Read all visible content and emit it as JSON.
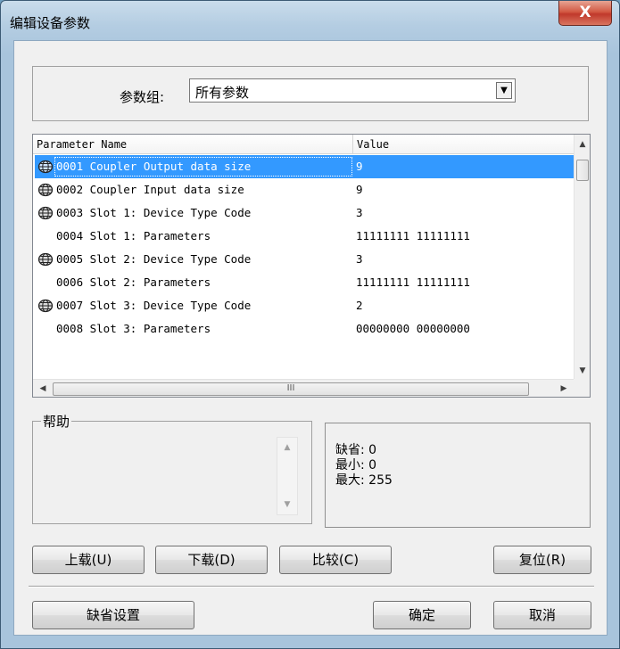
{
  "window": {
    "title": "编辑设备参数",
    "close_label": "X"
  },
  "param_group": {
    "label": "参数组:",
    "selected": "所有参数"
  },
  "list": {
    "columns": [
      "Parameter Name",
      "Value"
    ],
    "rows": [
      {
        "name": "0001 Coupler Output data size",
        "value": "9",
        "icon": "globe-icon",
        "selected": true
      },
      {
        "name": "0002 Coupler Input data size",
        "value": "9",
        "icon": "globe-icon",
        "selected": false
      },
      {
        "name": "0003 Slot 1: Device Type Code",
        "value": "3",
        "icon": "globe-icon",
        "selected": false
      },
      {
        "name": "0004 Slot 1: Parameters",
        "value": "11111111 11111111",
        "icon": "",
        "selected": false
      },
      {
        "name": "0005 Slot 2: Device Type Code",
        "value": "3",
        "icon": "globe-icon",
        "selected": false
      },
      {
        "name": "0006 Slot 2: Parameters",
        "value": "11111111 11111111",
        "icon": "",
        "selected": false
      },
      {
        "name": "0007 Slot 3: Device Type Code",
        "value": "2",
        "icon": "globe-icon",
        "selected": false
      },
      {
        "name": "0008 Slot 3: Parameters",
        "value": "00000000 00000000",
        "icon": "",
        "selected": false
      }
    ],
    "hscroll_grip": "III"
  },
  "help": {
    "label": "帮助"
  },
  "info": {
    "default_line": "缺省: 0",
    "min_line": "最小: 0",
    "max_line": "最大: 255"
  },
  "buttons": {
    "upload": "上载(U)",
    "download": "下载(D)",
    "compare": "比较(C)",
    "reset": "复位(R)",
    "defaults": "缺省设置",
    "ok": "确定",
    "cancel": "取消"
  }
}
